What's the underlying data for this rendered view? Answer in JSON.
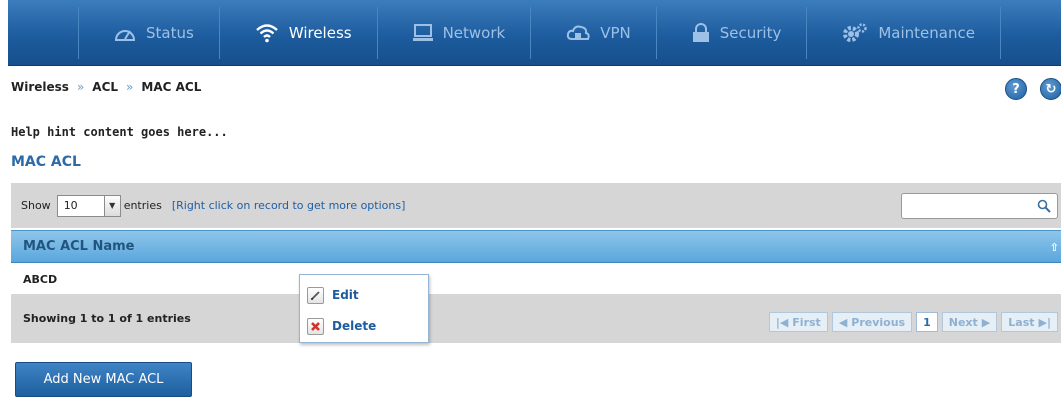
{
  "nav": {
    "items": [
      {
        "label": "Status",
        "icon": "gauge-icon"
      },
      {
        "label": "Wireless",
        "icon": "wifi-icon"
      },
      {
        "label": "Network",
        "icon": "monitor-icon"
      },
      {
        "label": "VPN",
        "icon": "cloud-lock-icon"
      },
      {
        "label": "Security",
        "icon": "padlock-icon"
      },
      {
        "label": "Maintenance",
        "icon": "gears-icon"
      }
    ],
    "active": "Wireless"
  },
  "breadcrumb": [
    "Wireless",
    "ACL",
    "MAC ACL"
  ],
  "breadcrumb_separator": "»",
  "help": {
    "help_label": "?",
    "refresh_label": "↻"
  },
  "hint_text": "Help hint content goes here...",
  "section_title": "MAC ACL",
  "toolbar": {
    "show_label": "Show",
    "entries_value": "10",
    "entries_label": "entries",
    "right_click_hint": "[Right click on record to get more options]",
    "search_placeholder": ""
  },
  "table": {
    "column_header": "MAC ACL Name",
    "rows": [
      "ABCD"
    ]
  },
  "footer": {
    "showing_text": "Showing 1 to 1 of 1 entries",
    "pager": {
      "first": "First",
      "previous": "Previous",
      "current": "1",
      "next": "Next",
      "last": "Last"
    }
  },
  "context_menu": {
    "edit": "Edit",
    "delete": "Delete"
  },
  "add_button_label": "Add New MAC ACL",
  "colors": {
    "nav_bg": "#1d5c9e",
    "header_bg": "#5aa7dc",
    "accent": "#2a6ba8",
    "delete_red": "#d0322a"
  }
}
